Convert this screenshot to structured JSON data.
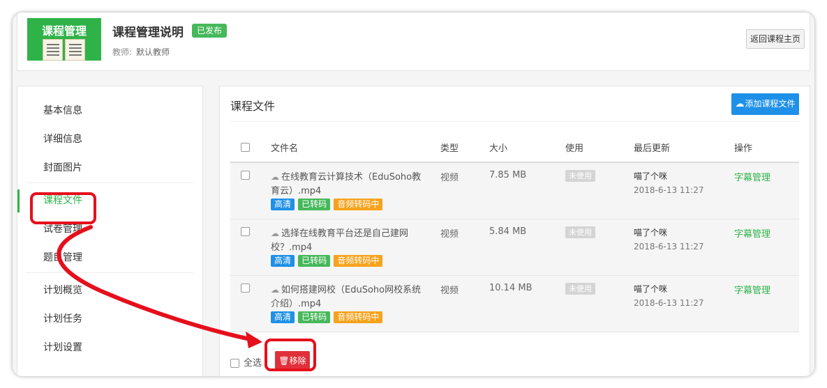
{
  "header": {
    "cover_title": "课程管理",
    "course_title": "课程管理说明",
    "status_badge": "已发布",
    "teacher_label": "教师:",
    "teacher_name": "默认教师",
    "back_button": "返回课程主页"
  },
  "sidebar": {
    "groups": [
      [
        "基本信息",
        "详细信息",
        "封面图片"
      ],
      [
        "课程文件",
        "试卷管理",
        "题目管理"
      ],
      [
        "计划概览",
        "计划任务",
        "计划设置"
      ]
    ],
    "active_item": "课程文件"
  },
  "main": {
    "title": "课程文件",
    "add_button": "添加课程文件",
    "columns": [
      "文件名",
      "类型",
      "大小",
      "使用",
      "最后更新",
      "操作"
    ],
    "files": [
      {
        "name": "在线教育云计算技术（EduSoho教育云）.mp4",
        "tags": [
          "高清",
          "已转码",
          "音频转码中"
        ],
        "type": "视频",
        "size": "7.85 MB",
        "usage": "未使用",
        "updated_by": "喵了个咪",
        "updated_at": "2018-6-13 11:27",
        "action": "字幕管理"
      },
      {
        "name": "选择在线教育平台还是自己建网校？.mp4",
        "tags": [
          "高清",
          "已转码",
          "音频转码中"
        ],
        "type": "视频",
        "size": "5.84 MB",
        "usage": "未使用",
        "updated_by": "喵了个咪",
        "updated_at": "2018-6-13 11:27",
        "action": "字幕管理"
      },
      {
        "name": "如何搭建网校（EduSoho网校系统介绍）.mp4",
        "tags": [
          "高清",
          "已转码",
          "音频转码中"
        ],
        "type": "视频",
        "size": "10.14 MB",
        "usage": "未使用",
        "updated_by": "喵了个咪",
        "updated_at": "2018-6-13 11:27",
        "action": "字幕管理"
      }
    ],
    "select_all": "全选",
    "remove_button": "移除"
  },
  "colors": {
    "brand_green": "#2fb349",
    "primary_blue": "#1e90e8",
    "danger_red": "#e0313b",
    "annotation_red": "#e5101c",
    "warning_orange": "#f7a21c"
  }
}
